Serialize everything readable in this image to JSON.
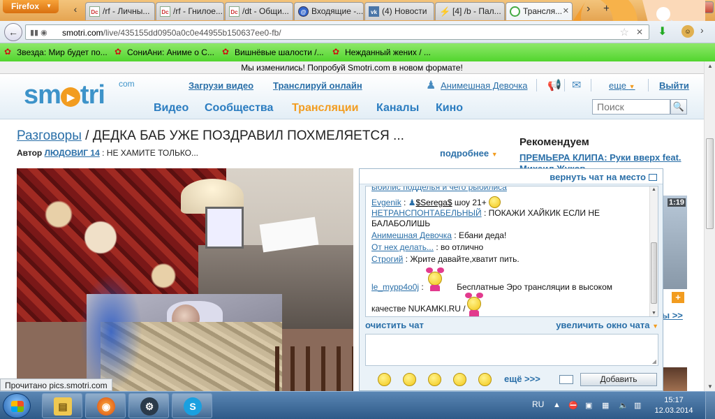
{
  "browser": {
    "menu_label": "Firefox",
    "tabs": [
      {
        "label": "/rf - Личны...",
        "icon": "dc"
      },
      {
        "label": "/rf - Гнилое...",
        "icon": "dc"
      },
      {
        "label": "/dt - Общи...",
        "icon": "dc"
      },
      {
        "label": "Входящие -...",
        "icon": "mail"
      },
      {
        "label": "(4) Новости",
        "icon": "vk"
      },
      {
        "label": "[4] /b - Пал...",
        "icon": "flash"
      },
      {
        "label": "Трансля...",
        "icon": "smotri",
        "active": true
      }
    ],
    "url_prefix": "smotri.com",
    "url_rest": "/live/435155dd0950a0c0e44955b150637ee0-fb/",
    "bookmarks": [
      "Звезда: Мир будет по...",
      "СониАни: Аниме о С...",
      "Вишнёвые шалости /...",
      "Нежданный жених / ..."
    ],
    "status_text": "Прочитано pics.smotri.com"
  },
  "site": {
    "promo": "Мы изменились! Попробуй Smotri.com в новом формате!",
    "logo": "smotri",
    "logo_suffix": "com",
    "top_links": {
      "upload": "Загрузи видео",
      "broadcast": "Транслируй онлайн",
      "user": "Анимешная Девочка",
      "more": "еще",
      "logout": "Выйти"
    },
    "nav": [
      "Видео",
      "Сообщества",
      "Трансляции",
      "Каналы",
      "Кино"
    ],
    "nav_active": 2,
    "search_placeholder": "Поиск"
  },
  "stream": {
    "category": "Разговоры",
    "title": "ДЕДКА БАБ УЖЕ ПОЗДРАВИЛ ПОХМЕЛЯЕТСЯ ...",
    "author_label": "Автор",
    "author": "ЛЮДОВИГ 14",
    "author_desc": "НЕ ХАМИТЕ ТОЛЬКО...",
    "details": "подробнее"
  },
  "recommend": {
    "title": "Рекомендуем",
    "link": "ПРЕМЬЕРА КЛИПА: Руки вверх feat. Михаил Жуков",
    "duration": "1:19",
    "more": "ы >>"
  },
  "chat": {
    "restore": "вернуть чат на место",
    "partial_top": "ыбилис подделья и чего рыбилиса",
    "messages": [
      {
        "user": "Evgenik",
        "sep": " : ",
        "mention": "$Serega$",
        "text": "шоу 21+"
      },
      {
        "user": "НЕТРАНСПОНТАБЕЛЬНЫЙ",
        "sep": " : ",
        "text": "ПОКАЖИ ХАЙКИК ЕСЛИ НЕ БАЛАБОЛИШЬ"
      },
      {
        "user": "Анимешная Девочка",
        "sep": " : ",
        "text": "Ебани деда!"
      },
      {
        "user": "От нех делать...",
        "sep": " : ",
        "text": "во отлично"
      },
      {
        "user": "Строгий",
        "sep": " : ",
        "text": "Жрите давайте,хватит пить."
      },
      {
        "user": "le_mypp4o0j",
        "sep": " : ",
        "text": "Бесплатные Эро трансляции в высоком"
      },
      {
        "text": "качестве NUKAMKI.RU /"
      }
    ],
    "clear": "очистить чат",
    "enlarge": "увеличить окно чата",
    "more_smileys": "ещё >>>",
    "add_button": "Добавить"
  },
  "taskbar": {
    "lang": "RU",
    "time": "15:17",
    "date": "12.03.2014"
  }
}
